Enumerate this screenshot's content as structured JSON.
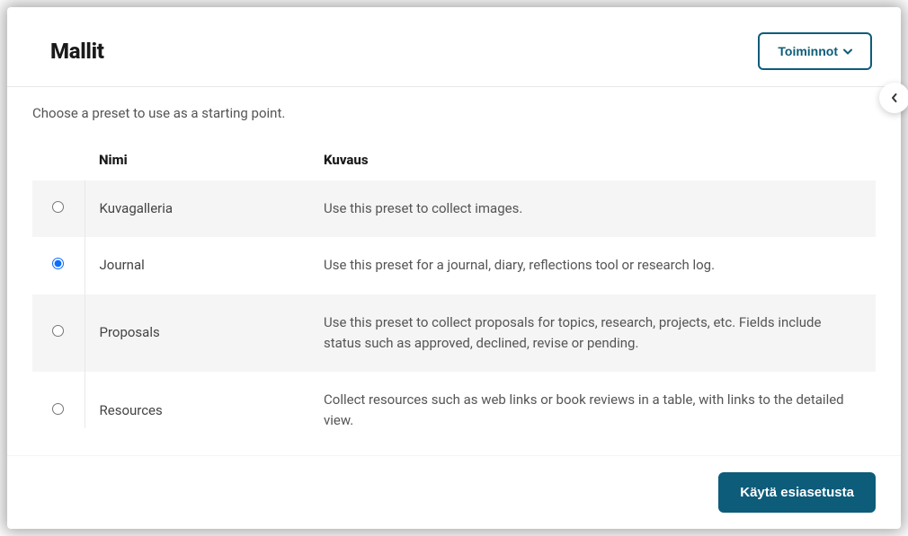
{
  "header": {
    "title": "Mallit",
    "actions_label": "Toiminnot"
  },
  "instruction": "Choose a preset to use as a starting point.",
  "columns": {
    "name": "Nimi",
    "description": "Kuvaus"
  },
  "rows": [
    {
      "name": "Kuvagalleria",
      "description": "Use this preset to collect images.",
      "selected": false
    },
    {
      "name": "Journal",
      "description": "Use this preset for a journal, diary, reflections tool or research log.",
      "selected": true
    },
    {
      "name": "Proposals",
      "description": "Use this preset to collect proposals for topics, research, projects, etc. Fields include status such as approved, declined, revise or pending.",
      "selected": false
    },
    {
      "name": "Resources",
      "description": "Collect resources such as web links or book reviews in a table, with links to the detailed view.",
      "selected": false
    }
  ],
  "footer": {
    "submit_label": "Käytä esiasetusta"
  }
}
